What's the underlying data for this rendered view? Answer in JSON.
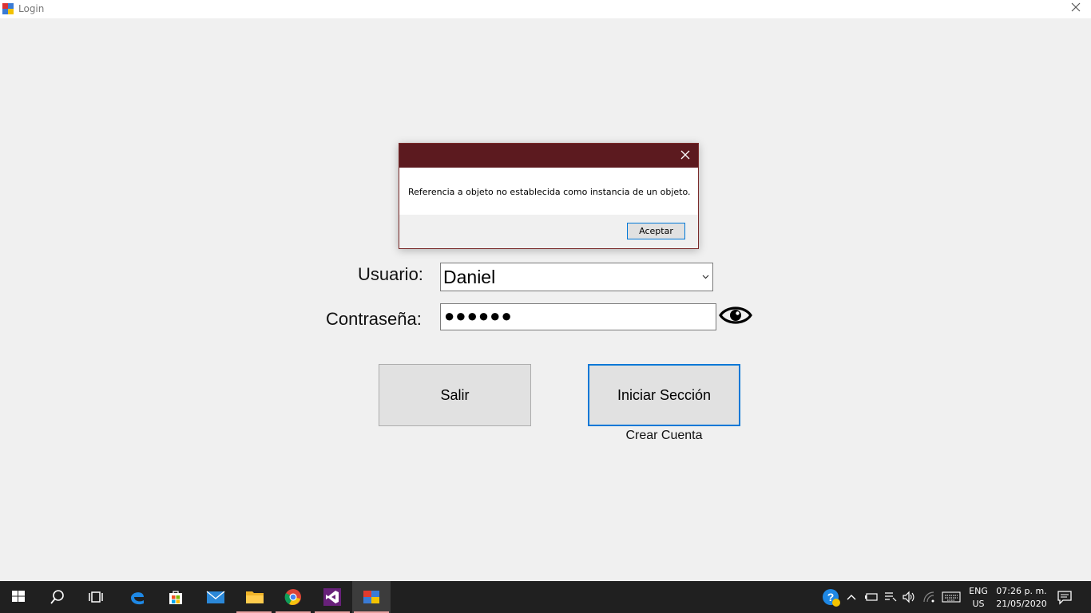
{
  "window": {
    "title": "Login"
  },
  "form": {
    "user_label": "Usuario:",
    "user_value": "Daniel",
    "password_label": "Contraseña:",
    "password_masked": "●●●●●●",
    "exit_label": "Salir",
    "login_label": "Iniciar Sección",
    "create_account_label": "Crear Cuenta"
  },
  "dialog": {
    "message": "Referencia a objeto no establecida como instancia de un objeto.",
    "ok_label": "Aceptar",
    "title_color": "#5c1a1f"
  },
  "taskbar": {
    "icons": [
      "windows-start-icon",
      "search-icon",
      "task-view-icon",
      "edge-icon",
      "store-icon",
      "mail-icon",
      "file-explorer-icon",
      "chrome-icon",
      "visual-studio-icon",
      "login-app-icon"
    ],
    "tray": {
      "lang_line1": "ENG",
      "lang_line2": "US",
      "time": "07:26 p. m.",
      "date": "21/05/2020"
    }
  }
}
